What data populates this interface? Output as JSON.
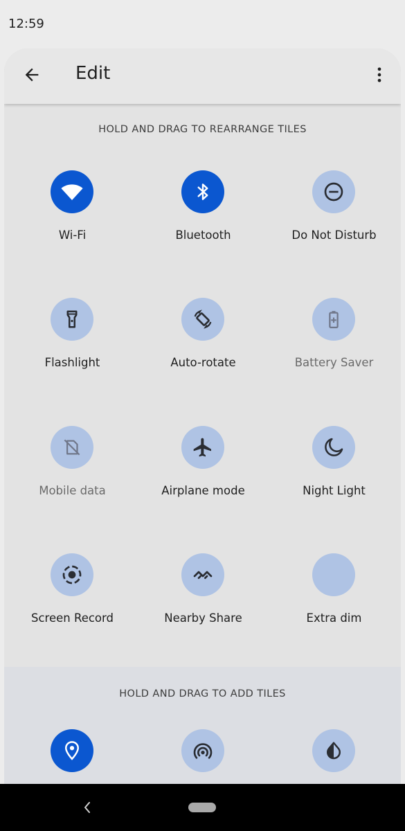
{
  "status_bar": {
    "time": "12:59"
  },
  "toolbar": {
    "title": "Edit"
  },
  "sections": {
    "current_title": "HOLD AND DRAG TO REARRANGE TILES",
    "add_title": "HOLD AND DRAG TO ADD TILES"
  },
  "tiles": [
    {
      "label": "Wi-Fi",
      "icon": "wifi-icon",
      "state": "on"
    },
    {
      "label": "Bluetooth",
      "icon": "bluetooth-icon",
      "state": "on"
    },
    {
      "label": "Do Not Disturb",
      "icon": "do-not-disturb-icon",
      "state": "off"
    },
    {
      "label": "Flashlight",
      "icon": "flashlight-icon",
      "state": "off"
    },
    {
      "label": "Auto-rotate",
      "icon": "auto-rotate-icon",
      "state": "off"
    },
    {
      "label": "Battery Saver",
      "icon": "battery-saver-icon",
      "state": "unavailable"
    },
    {
      "label": "Mobile data",
      "icon": "mobile-data-off-icon",
      "state": "unavailable"
    },
    {
      "label": "Airplane mode",
      "icon": "airplane-icon",
      "state": "off"
    },
    {
      "label": "Night Light",
      "icon": "moon-icon",
      "state": "off"
    },
    {
      "label": "Screen Record",
      "icon": "screen-record-icon",
      "state": "off"
    },
    {
      "label": "Nearby Share",
      "icon": "nearby-share-icon",
      "state": "off"
    },
    {
      "label": "Extra dim",
      "icon": "extra-dim-icon",
      "state": "off"
    }
  ],
  "add_tiles": [
    {
      "icon": "location-icon",
      "state": "on"
    },
    {
      "icon": "hotspot-icon",
      "state": "off"
    },
    {
      "icon": "color-inversion-icon",
      "state": "off"
    }
  ],
  "colors": {
    "tile_on": "#0b57d0",
    "tile_off": "#afc3e4",
    "panel": "#e3e3e3",
    "add_section": "#dcdee3"
  }
}
